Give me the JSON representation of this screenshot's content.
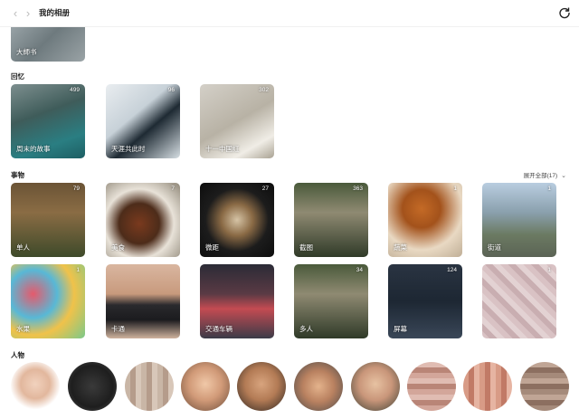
{
  "header": {
    "title": "我的相册",
    "back_icon": "‹",
    "forward_icon": "›"
  },
  "top_partial": {
    "label": "大師书"
  },
  "memories": {
    "title": "回忆",
    "items": [
      {
        "label": "周末的故事",
        "count": "499"
      },
      {
        "label": "天涯共此时",
        "count": "96"
      },
      {
        "label": "十一中国红",
        "count": "302"
      }
    ]
  },
  "things": {
    "title": "事物",
    "expand_label": "展开全部(17)",
    "items": [
      {
        "label": "单人",
        "count": "79"
      },
      {
        "label": "美食",
        "count": "7"
      },
      {
        "label": "微距",
        "count": "27"
      },
      {
        "label": "截图",
        "count": "363"
      },
      {
        "label": "蔬菜",
        "count": "1"
      },
      {
        "label": "街道",
        "count": "1"
      },
      {
        "label": "水果",
        "count": "1"
      },
      {
        "label": "卡通",
        "count": ""
      },
      {
        "label": "交通车辆",
        "count": ""
      },
      {
        "label": "多人",
        "count": "34"
      },
      {
        "label": "屏幕",
        "count": "124"
      },
      {
        "label": "",
        "count": "1"
      }
    ]
  },
  "people": {
    "title": "人物"
  },
  "colors": {
    "accent": "#222222",
    "muted": "#bbbbbb"
  }
}
